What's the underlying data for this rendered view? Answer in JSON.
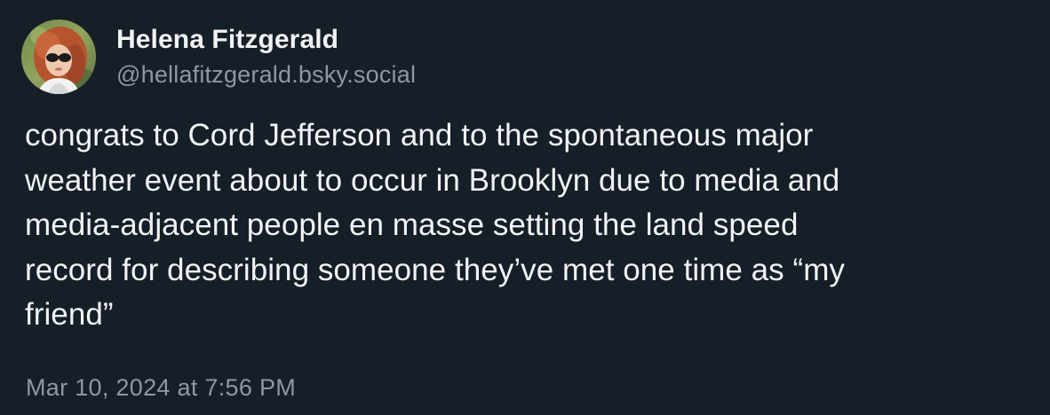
{
  "post": {
    "author": {
      "display_name": "Helena Fitzgerald",
      "handle": "@hellafitzgerald.bsky.social",
      "avatar_icon": "profile-photo"
    },
    "text_lines": [
      "congrats to Cord Jefferson and to the spontaneous major",
      "weather event about to occur in Brooklyn due to media and",
      "media-adjacent people en masse setting the land speed",
      "record for describing someone they’ve met one time as “my",
      "friend”"
    ],
    "timestamp": "Mar 10, 2024 at 7:56 PM"
  },
  "colors": {
    "background": "#161e27",
    "primary_text": "#f1f3f5",
    "secondary_text": "#8d98a5"
  }
}
